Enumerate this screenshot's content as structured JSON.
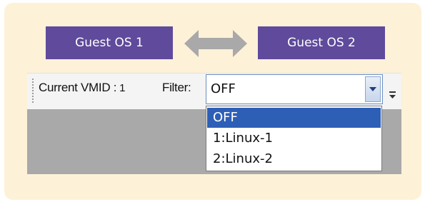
{
  "guests": {
    "left_label": "Guest OS 1",
    "right_label": "Guest OS 2"
  },
  "toolbar": {
    "vmid_label": "Current VMID :",
    "vmid_value": "1",
    "filter_label": "Filter:",
    "filter_value": "OFF"
  },
  "filter_options": [
    "OFF",
    "1:Linux-1",
    "2:Linux-2"
  ],
  "selected_option_index": 0,
  "icons": {
    "swap": "double-arrow-icon",
    "dropdown": "chevron-down-icon",
    "overflow": "toolbar-overflow-icon"
  },
  "colors": {
    "panel_bg": "#fdf1d8",
    "guest_box": "#5f4a9b",
    "selection": "#2d5fb7",
    "content_area": "#a9a9a9"
  }
}
